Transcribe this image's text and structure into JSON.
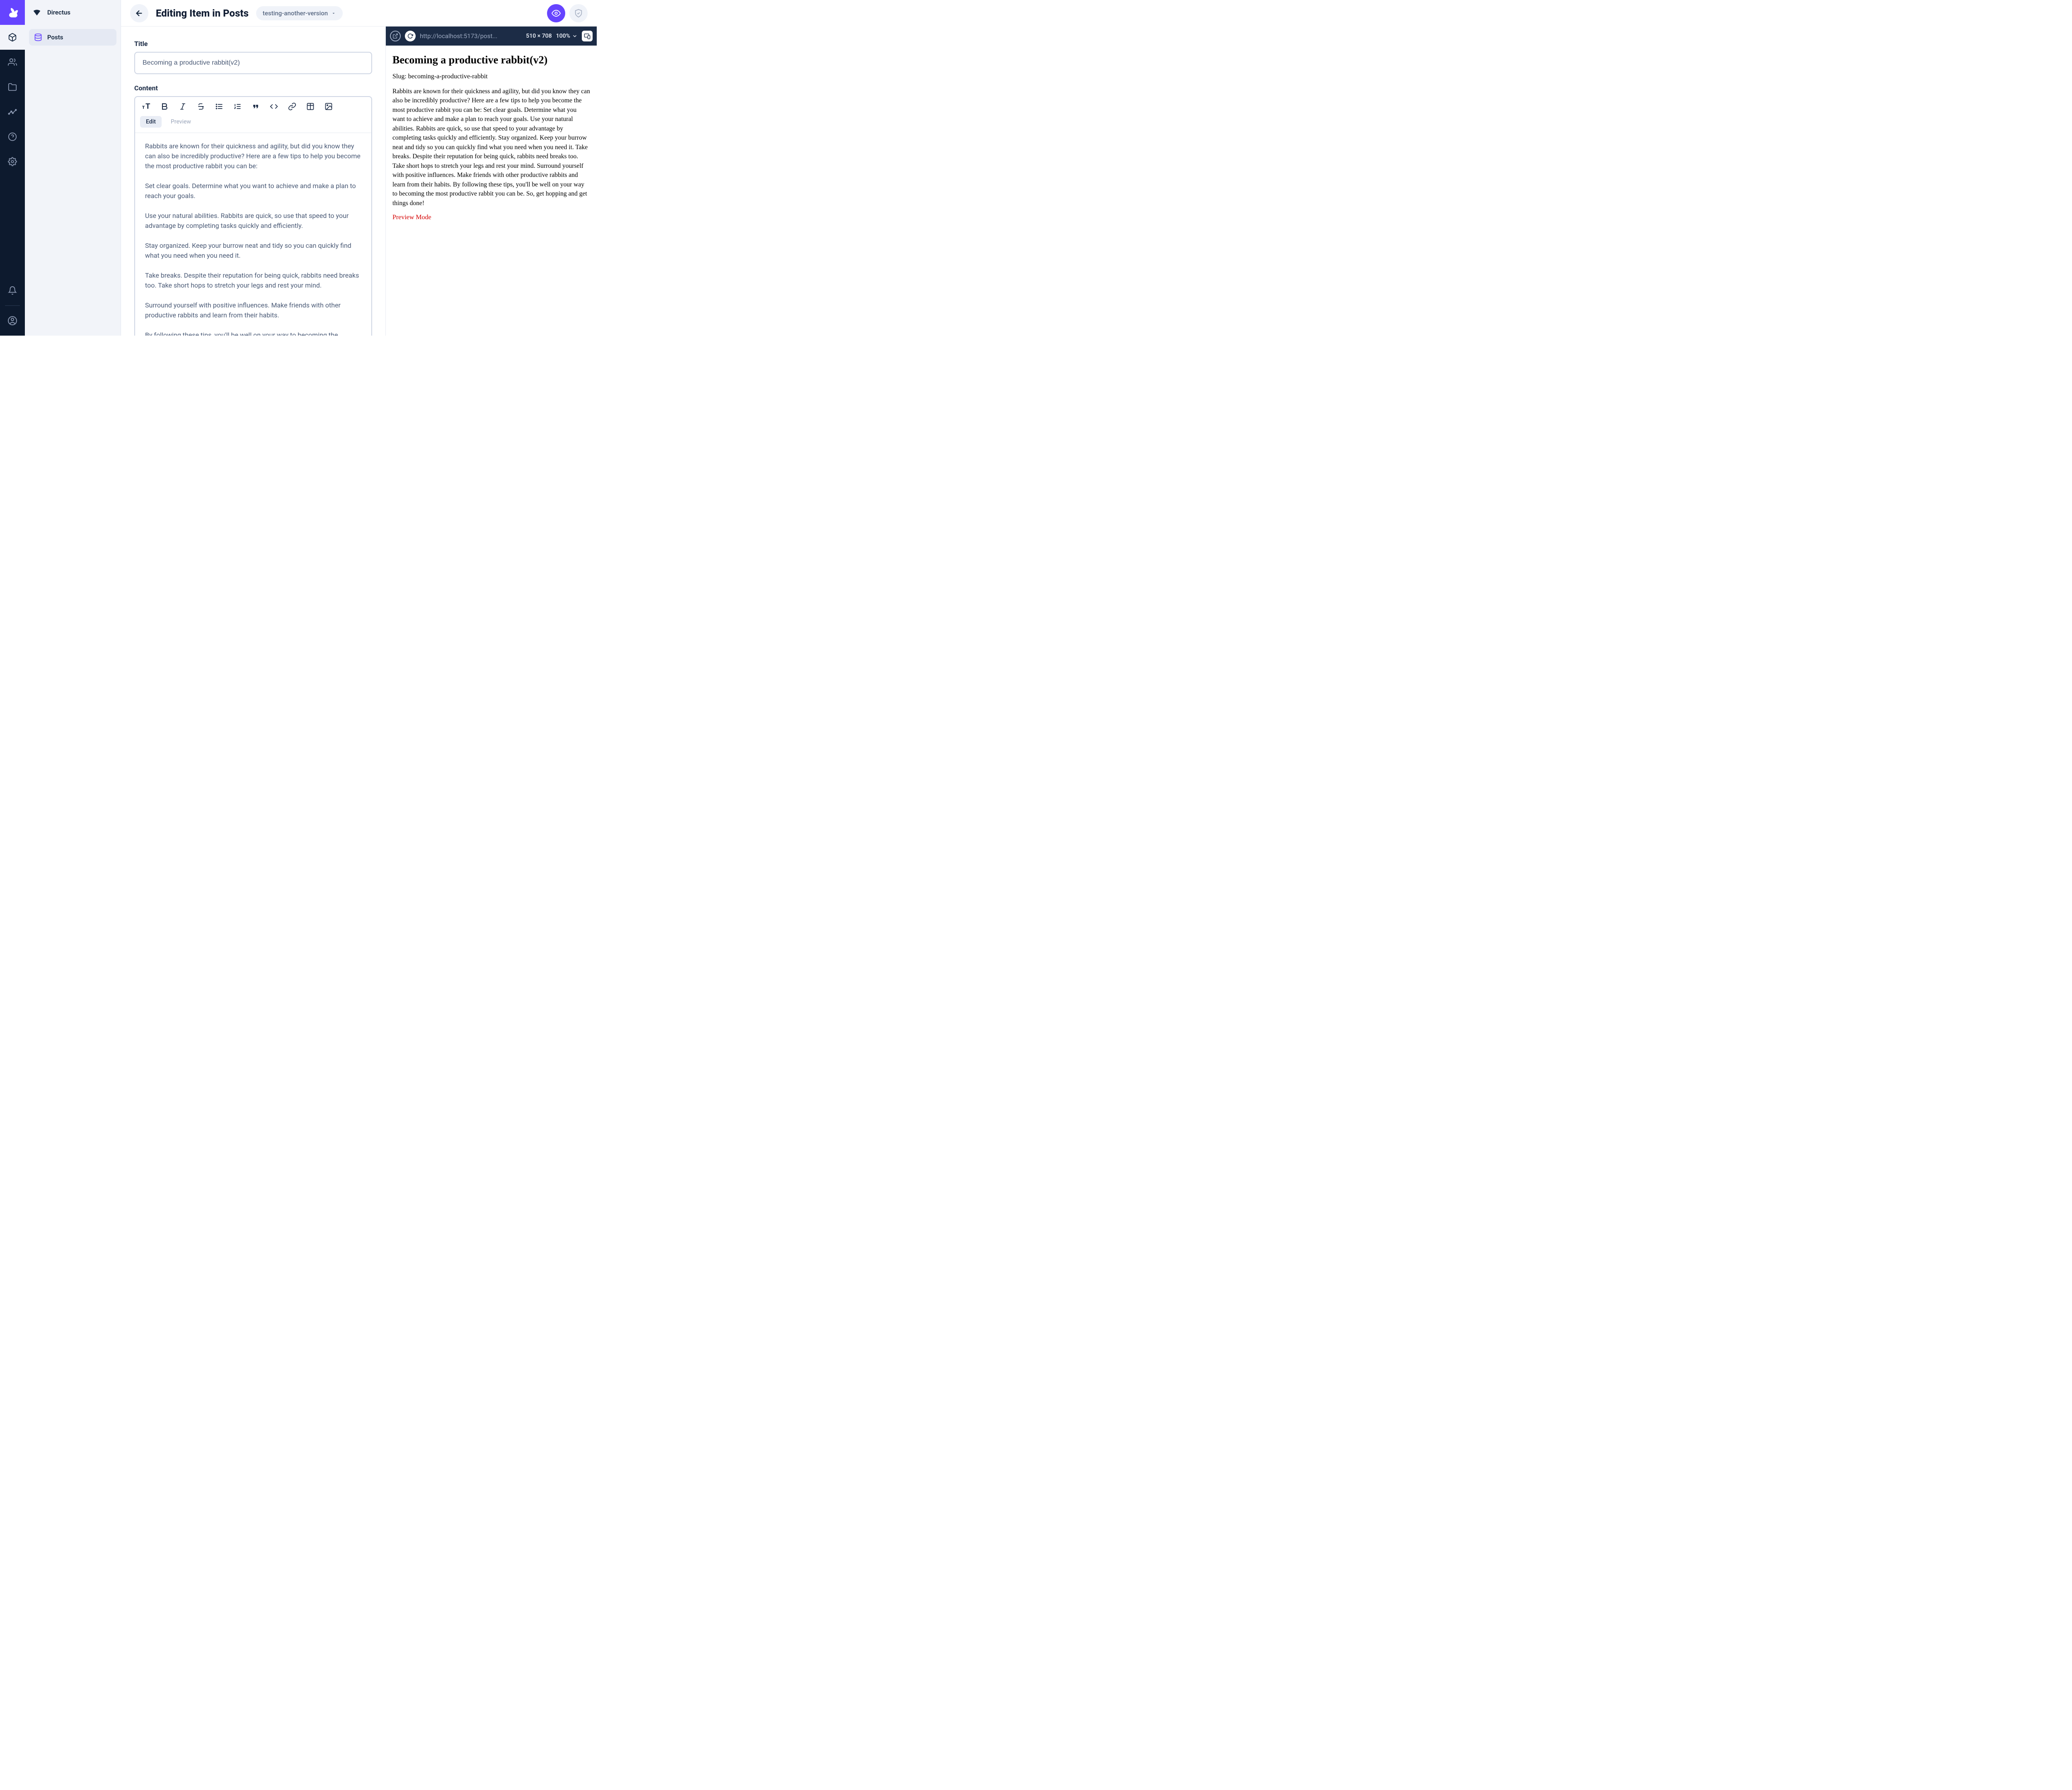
{
  "app_name": "Directus",
  "sidebar": {
    "items": [
      {
        "label": "Posts"
      }
    ]
  },
  "topbar": {
    "title": "Editing Item in Posts",
    "version_label": "testing-another-version"
  },
  "fields": {
    "title_label": "Title",
    "title_value": "Becoming a productive rabbit(v2)",
    "content_label": "Content",
    "tabs": {
      "edit": "Edit",
      "preview": "Preview"
    },
    "body": "Rabbits are known for their quickness and agility, but did you know they can also be incredibly productive? Here are a few tips to help you become the most productive rabbit you can be:\n\nSet clear goals. Determine what you want to achieve and make a plan to reach your goals.\n\nUse your natural abilities. Rabbits are quick, so use that speed to your advantage by completing tasks quickly and efficiently.\n\nStay organized. Keep your burrow neat and tidy so you can quickly find what you need when you need it.\n\nTake breaks. Despite their reputation for being quick, rabbits need breaks too. Take short hops to stretch your legs and rest your mind.\n\nSurround yourself with positive influences. Make friends with other productive rabbits and learn from their habits.\n\nBy following these tips, you'll be well on your way to becoming the"
  },
  "preview": {
    "url": "http://localhost:5173/post...",
    "dimensions": "510 × 708",
    "zoom": "100%",
    "doc_title": "Becoming a productive rabbit(v2)",
    "slug_label": "Slug: becoming-a-productive-rabbit",
    "body": "Rabbits are known for their quickness and agility, but did you know they can also be incredibly productive? Here are a few tips to help you become the most productive rabbit you can be: Set clear goals. Determine what you want to achieve and make a plan to reach your goals. Use your natural abilities. Rabbits are quick, so use that speed to your advantage by completing tasks quickly and efficiently. Stay organized. Keep your burrow neat and tidy so you can quickly find what you need when you need it. Take breaks. Despite their reputation for being quick, rabbits need breaks too. Take short hops to stretch your legs and rest your mind. Surround yourself with positive influences. Make friends with other productive rabbits and learn from their habits. By following these tips, you'll be well on your way to becoming the most productive rabbit you can be. So, get hopping and get things done!",
    "mode": "Preview Mode"
  }
}
